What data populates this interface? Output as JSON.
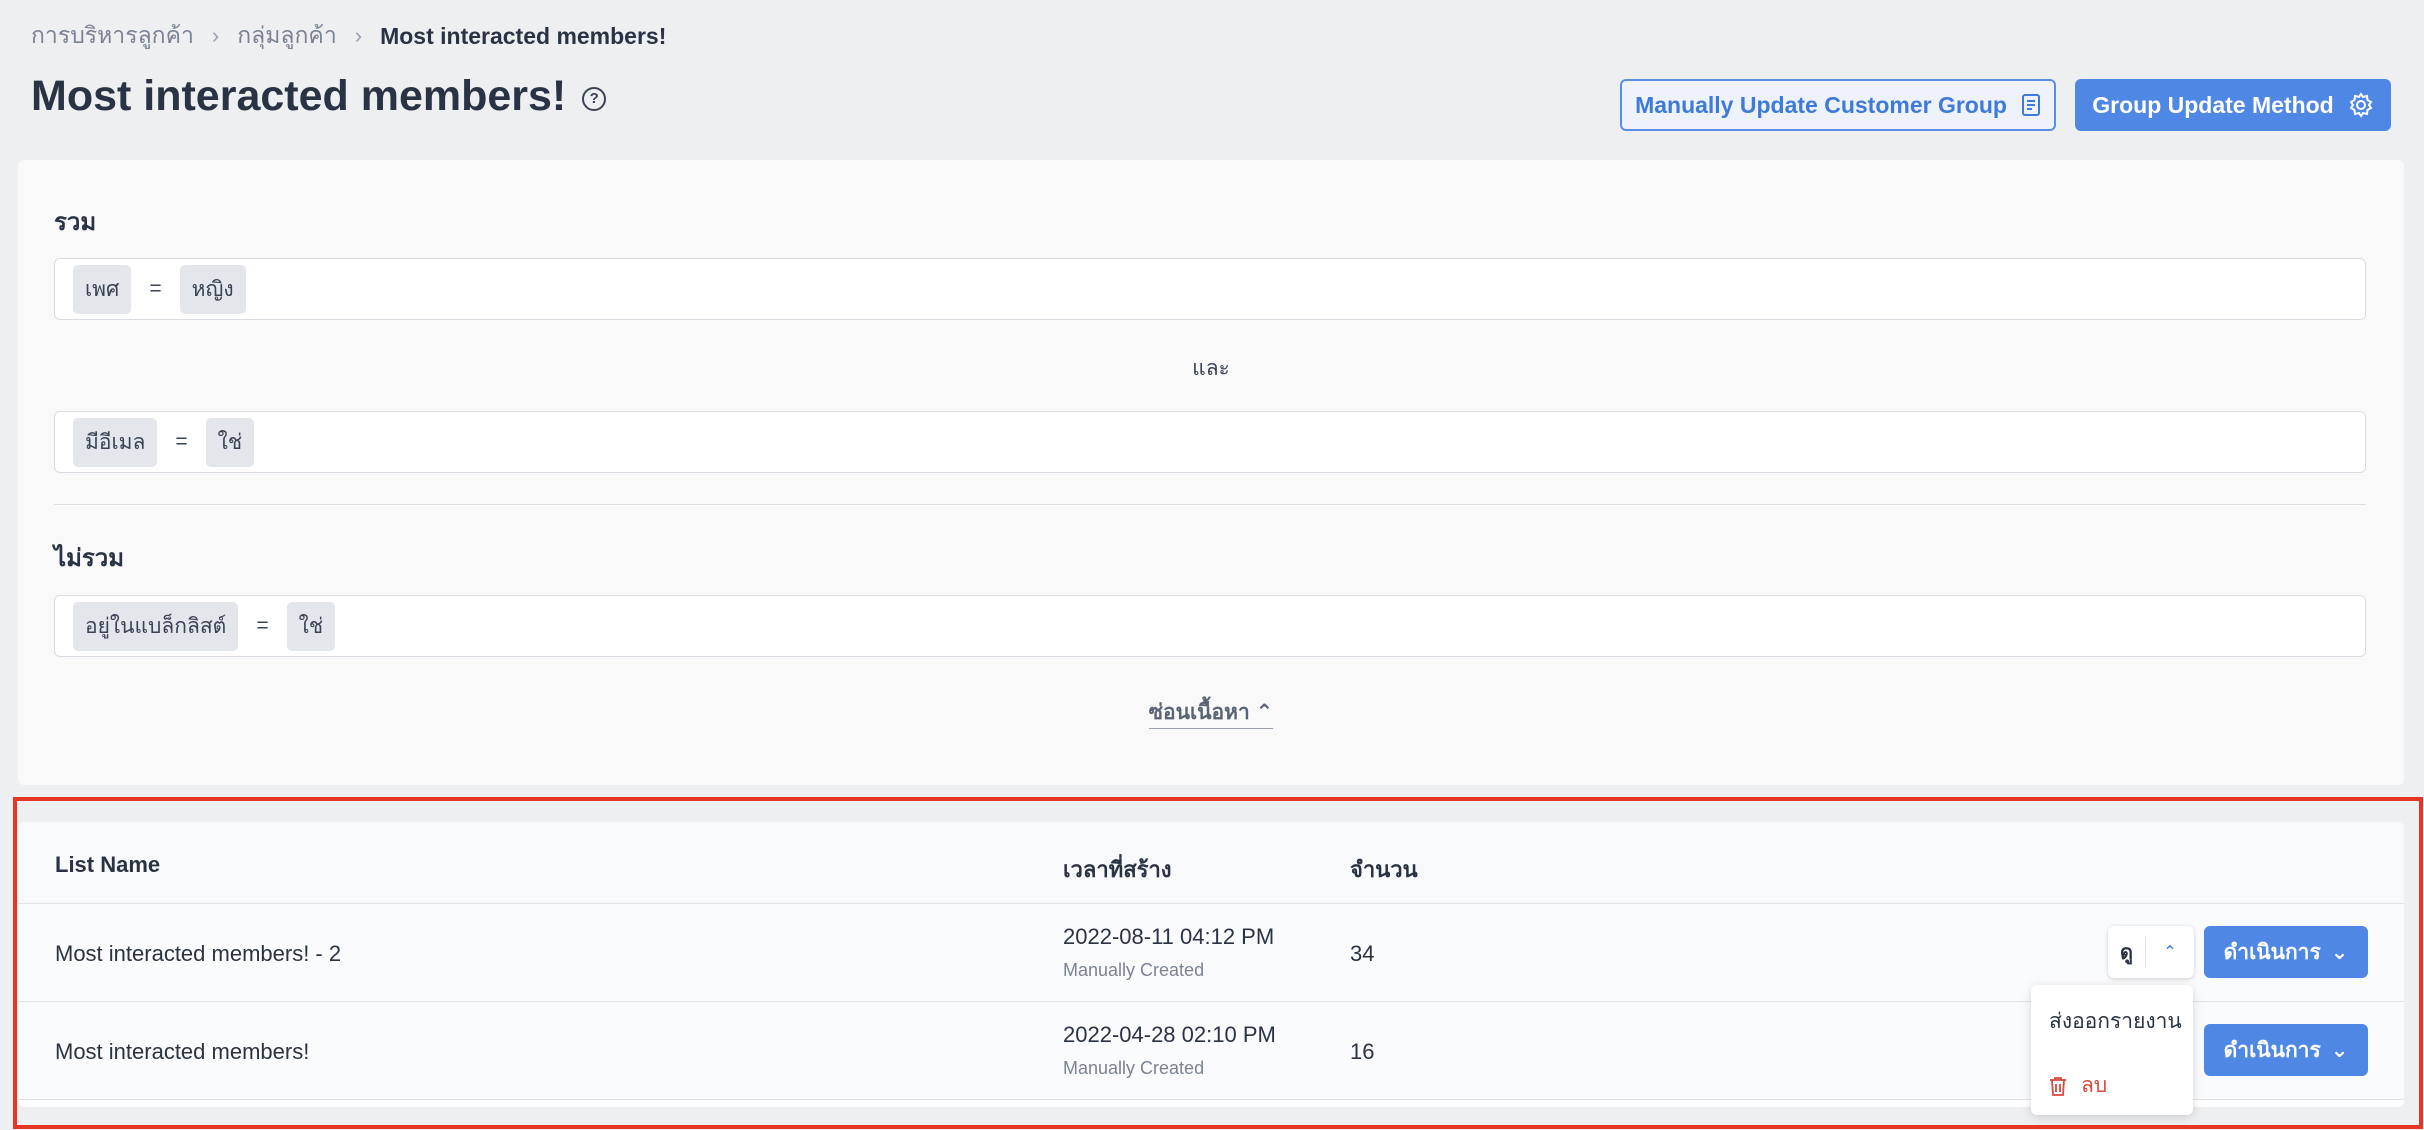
{
  "breadcrumb": {
    "items": [
      "การบริหารลูกค้า",
      "กลุ่มลูกค้า"
    ],
    "current": "Most interacted members!"
  },
  "header": {
    "title": "Most interacted members!",
    "manual_update_label": "Manually Update Customer Group",
    "group_update_method_label": "Group Update Method"
  },
  "filters": {
    "include_label": "รวม",
    "and_label": "และ",
    "exclude_label": "ไม่รวม",
    "conditions": [
      {
        "field": "เพศ",
        "op": "=",
        "value": "หญิง"
      },
      {
        "field": "มีอีเมล",
        "op": "=",
        "value": "ใช่"
      }
    ],
    "exclude_conditions": [
      {
        "field": "อยู่ในแบล็กลิสต์",
        "op": "=",
        "value": "ใช่"
      }
    ],
    "hide_label": "ซ่อนเนื้อหา"
  },
  "table": {
    "columns": [
      "List Name",
      "เวลาที่สร้าง",
      "จำนวน"
    ],
    "rows": [
      {
        "name": "Most interacted members! - 2",
        "created": "2022-08-11 04:12 PM",
        "method": "Manually Created",
        "count": "34"
      },
      {
        "name": "Most interacted members!",
        "created": "2022-04-28 02:10 PM",
        "method": "Manually Created",
        "count": "16"
      }
    ],
    "view_label": "ดู",
    "action_label": "ดำเนินการ"
  },
  "dropdown": {
    "export_label": "ส่งออกรายงาน",
    "delete_label": "ลบ"
  },
  "colors": {
    "primary": "#4f87e4",
    "highlight": "#e53524",
    "danger": "#d9483b"
  }
}
